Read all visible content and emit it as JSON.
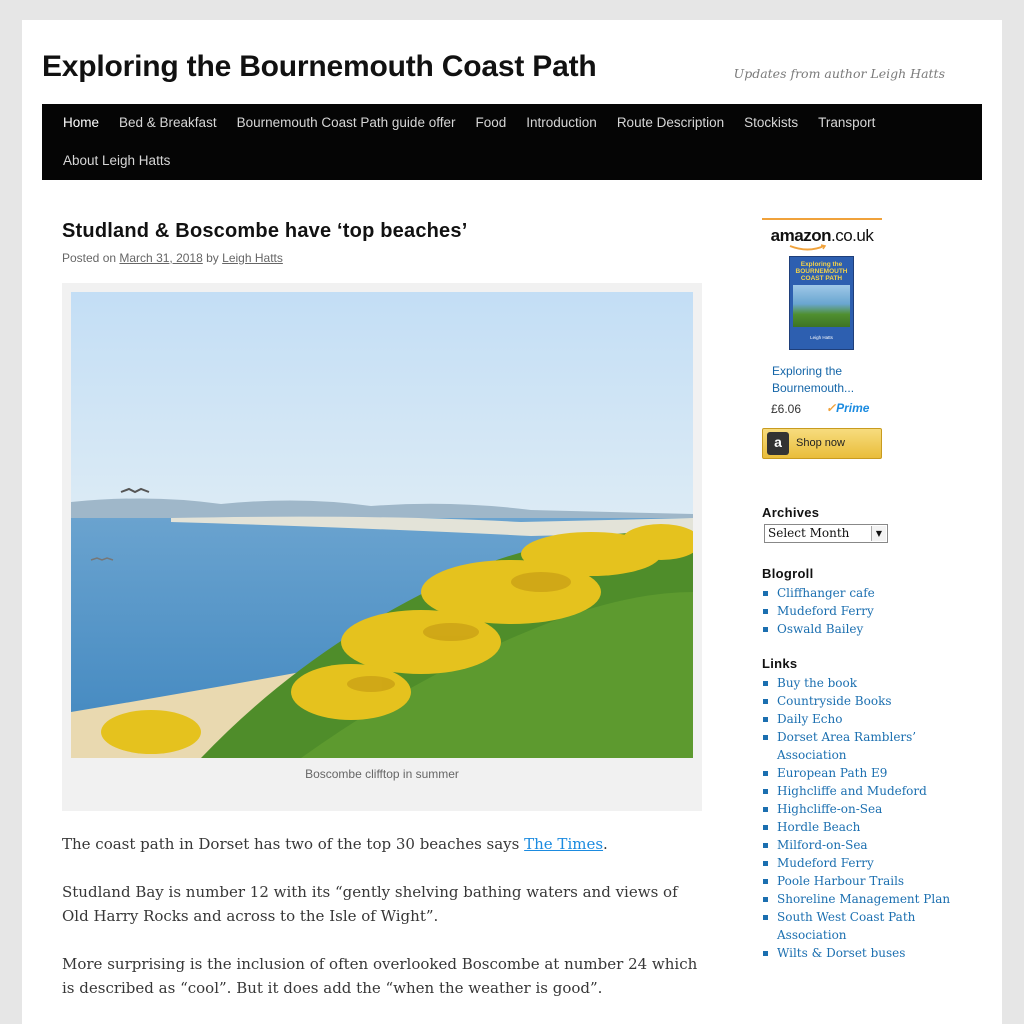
{
  "site": {
    "title": "Exploring the Bournemouth Coast Path",
    "description": "Updates from author Leigh Hatts"
  },
  "nav": {
    "items": [
      {
        "label": "Home",
        "current": true
      },
      {
        "label": "Bed & Breakfast"
      },
      {
        "label": "Bournemouth Coast Path guide offer"
      },
      {
        "label": "Food"
      },
      {
        "label": "Introduction"
      },
      {
        "label": "Route Description"
      },
      {
        "label": "Stockists"
      },
      {
        "label": "Transport"
      },
      {
        "label": "About Leigh Hatts"
      }
    ]
  },
  "post": {
    "title": "Studland & Boscombe have ‘top beaches’",
    "meta_prefix": "Posted on",
    "date": "March 31, 2018",
    "meta_by": "by",
    "author": "Leigh Hatts",
    "caption": "Boscombe clifftop in summer",
    "p1_text": "The coast path in Dorset has two of the top 30 beaches says ",
    "p1_link": "The Times",
    "p1_end": ".",
    "p2": "Studland Bay is number 12 with its “gently shelving bathing waters and views of Old Harry Rocks and across to the Isle of Wight”.",
    "p3": "More surprising is the inclusion of often overlooked Boscombe at number 24 which is described as “cool”. But it does add the “when the weather is good”."
  },
  "sidebar": {
    "amazon": {
      "logo": "amazon",
      "logo_domain": ".co.uk",
      "cover_title": "Exploring the BOURNEMOUTH COAST PATH",
      "cover_author": "Leigh Hatts",
      "book_title": "Exploring the Bournemouth...",
      "price": "£6.06",
      "prime": "Prime",
      "shop_icon": "a",
      "shop_label": "Shop now"
    },
    "archives": {
      "title": "Archives",
      "selected": "Select Month"
    },
    "blogroll": {
      "title": "Blogroll",
      "items": [
        "Cliffhanger cafe",
        "Mudeford Ferry",
        "Oswald Bailey"
      ]
    },
    "links": {
      "title": "Links",
      "items": [
        "Buy the book",
        "Countryside Books",
        "Daily Echo",
        "Dorset Area Ramblers’ Association",
        "European Path E9",
        "Highcliffe and Mudeford",
        "Highcliffe-on-Sea",
        "Hordle Beach",
        "Milford-on-Sea",
        "Mudeford Ferry",
        "Poole Harbour Trails",
        "Shoreline Management Plan",
        "South West Coast Path Association",
        "Wilts & Dorset buses"
      ]
    }
  },
  "colors": {
    "nav_bg": "#050505",
    "link": "#1b6fb0",
    "amazon_orange": "#f0a23b"
  }
}
